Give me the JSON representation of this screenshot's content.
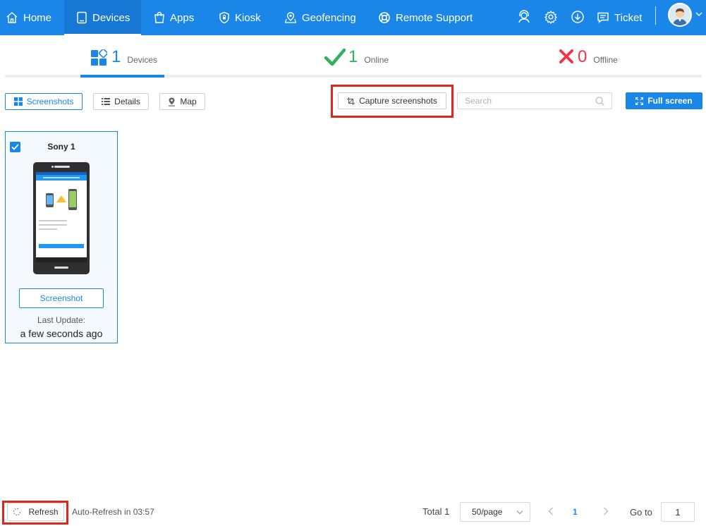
{
  "nav": {
    "items": [
      {
        "label": "Home",
        "icon": "home-icon"
      },
      {
        "label": "Devices",
        "icon": "tablet-icon",
        "active": true
      },
      {
        "label": "Apps",
        "icon": "shopping-bag-icon"
      },
      {
        "label": "Kiosk",
        "icon": "shield-lock-icon"
      },
      {
        "label": "Geofencing",
        "icon": "map-pin-icon"
      },
      {
        "label": "Remote Support",
        "icon": "lifebuoy-icon"
      }
    ],
    "ticket_label": "Ticket",
    "icons": [
      "support-agent-icon",
      "gear-icon",
      "download-icon",
      "chat-icon"
    ],
    "accent_color": "#1a87e8"
  },
  "stats": {
    "devices": {
      "count": "1",
      "label": "Devices"
    },
    "online": {
      "count": "1",
      "label": "Online",
      "color": "#2eb35a"
    },
    "offline": {
      "count": "0",
      "label": "Offline",
      "color": "#f0364a"
    }
  },
  "toolbar": {
    "view_screenshots": "Screenshots",
    "view_details": "Details",
    "view_map": "Map",
    "capture_label": "Capture screenshots",
    "search_placeholder": "Search",
    "full_screen_label": "Full screen"
  },
  "devices": [
    {
      "name": "Sony 1",
      "checked": true,
      "screenshot_button": "Screenshot",
      "last_update_label": "Last Update:",
      "last_update_value": "a few seconds ago"
    }
  ],
  "footer": {
    "refresh_label": "Refresh",
    "auto_refresh": "Auto-Refresh in 03:57",
    "total": "Total 1",
    "page_size": "50/page",
    "current_page": "1",
    "goto_label": "Go to",
    "goto_value": "1"
  }
}
